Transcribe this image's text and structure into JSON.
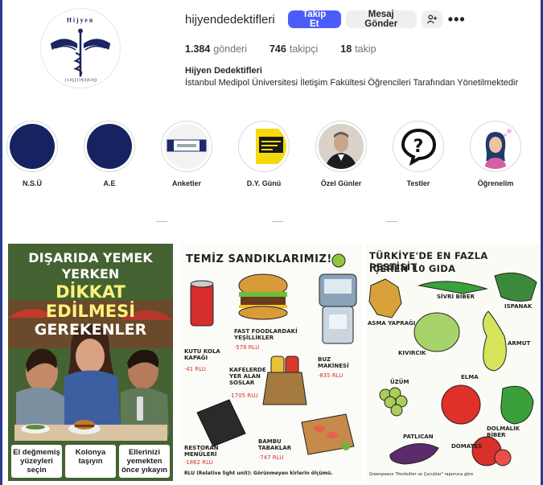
{
  "profile": {
    "username": "hijyendedektifleri",
    "follow_label": "Takip Et",
    "message_label": "Mesaj Gönder",
    "add_icon": "person-add-icon",
    "more_icon": "more-horizontal-icon",
    "posts_count": "1.384",
    "posts_label": "gönderi",
    "followers_count": "746",
    "followers_label": "takipçi",
    "following_count": "18",
    "following_label": "takip",
    "full_name": "Hijyen Dedektifleri",
    "bio": "İstanbul Medipol Üniversitesi İletişim Fakültesi Öğrencileri Tarafından Yönetilmektedir",
    "logo_text_top": "Hijyen",
    "logo_text_bottom": "Dedektifleri"
  },
  "highlights": [
    {
      "label": "N.S.Ü"
    },
    {
      "label": "A.E"
    },
    {
      "label": "Anketler"
    },
    {
      "label": "D.Y. Günü"
    },
    {
      "label": "Özel Günler"
    },
    {
      "label": "Testler"
    },
    {
      "label": "Öğrenelim"
    }
  ],
  "posts": {
    "post1": {
      "title_line1": "DIŞARIDA YEMEK YERKEN",
      "title_line2": "DİKKAT EDİLMESİ",
      "title_line3": "GEREKENLER",
      "tips": [
        "El değmemiş yüzeyleri seçin",
        "Kolonya taşıyın",
        "Ellerinizi yemekten önce yıkayın"
      ]
    },
    "post2": {
      "title": "TEMİZ SANDIKLARIMIZ!",
      "items": [
        {
          "name": "KUTU KOLA KAPAĞI",
          "value": "·41 RLU"
        },
        {
          "name": "FAST FOODLARDAKİ YEŞİLLİKLER",
          "value": "·578 RLU"
        },
        {
          "name": "BUZ MAKİNESİ",
          "value": "·835 RLU"
        },
        {
          "name": "KAFELERDE YER ALAN SOSLAR",
          "value": "·1705 RLU"
        },
        {
          "name": "RESTORAN MENÜLERİ",
          "value": "·1862 RLU"
        },
        {
          "name": "BAMBU TABAKLAR",
          "value": "·747 RLU"
        }
      ],
      "footnote": "RLU (Relative light unit): Görünmeyen kirlerin ölçümü."
    },
    "post3": {
      "title_line1": "TÜRKİYE'DE EN FAZLA PESTİSİT",
      "title_line2": "İÇEREN 10 GIDA",
      "items": [
        "ASMA YAPRAĞI",
        "SİVRİ BİBER",
        "ISPANAK",
        "KIVIRCIK",
        "ARMUT",
        "ÜZÜM",
        "ELMA",
        "DOLMALIK BİBER",
        "PATLICAN",
        "DOMATES"
      ],
      "footnote": "Greenpeace \"Pestisitler ve Çocuklar\" raporuna göre"
    }
  }
}
